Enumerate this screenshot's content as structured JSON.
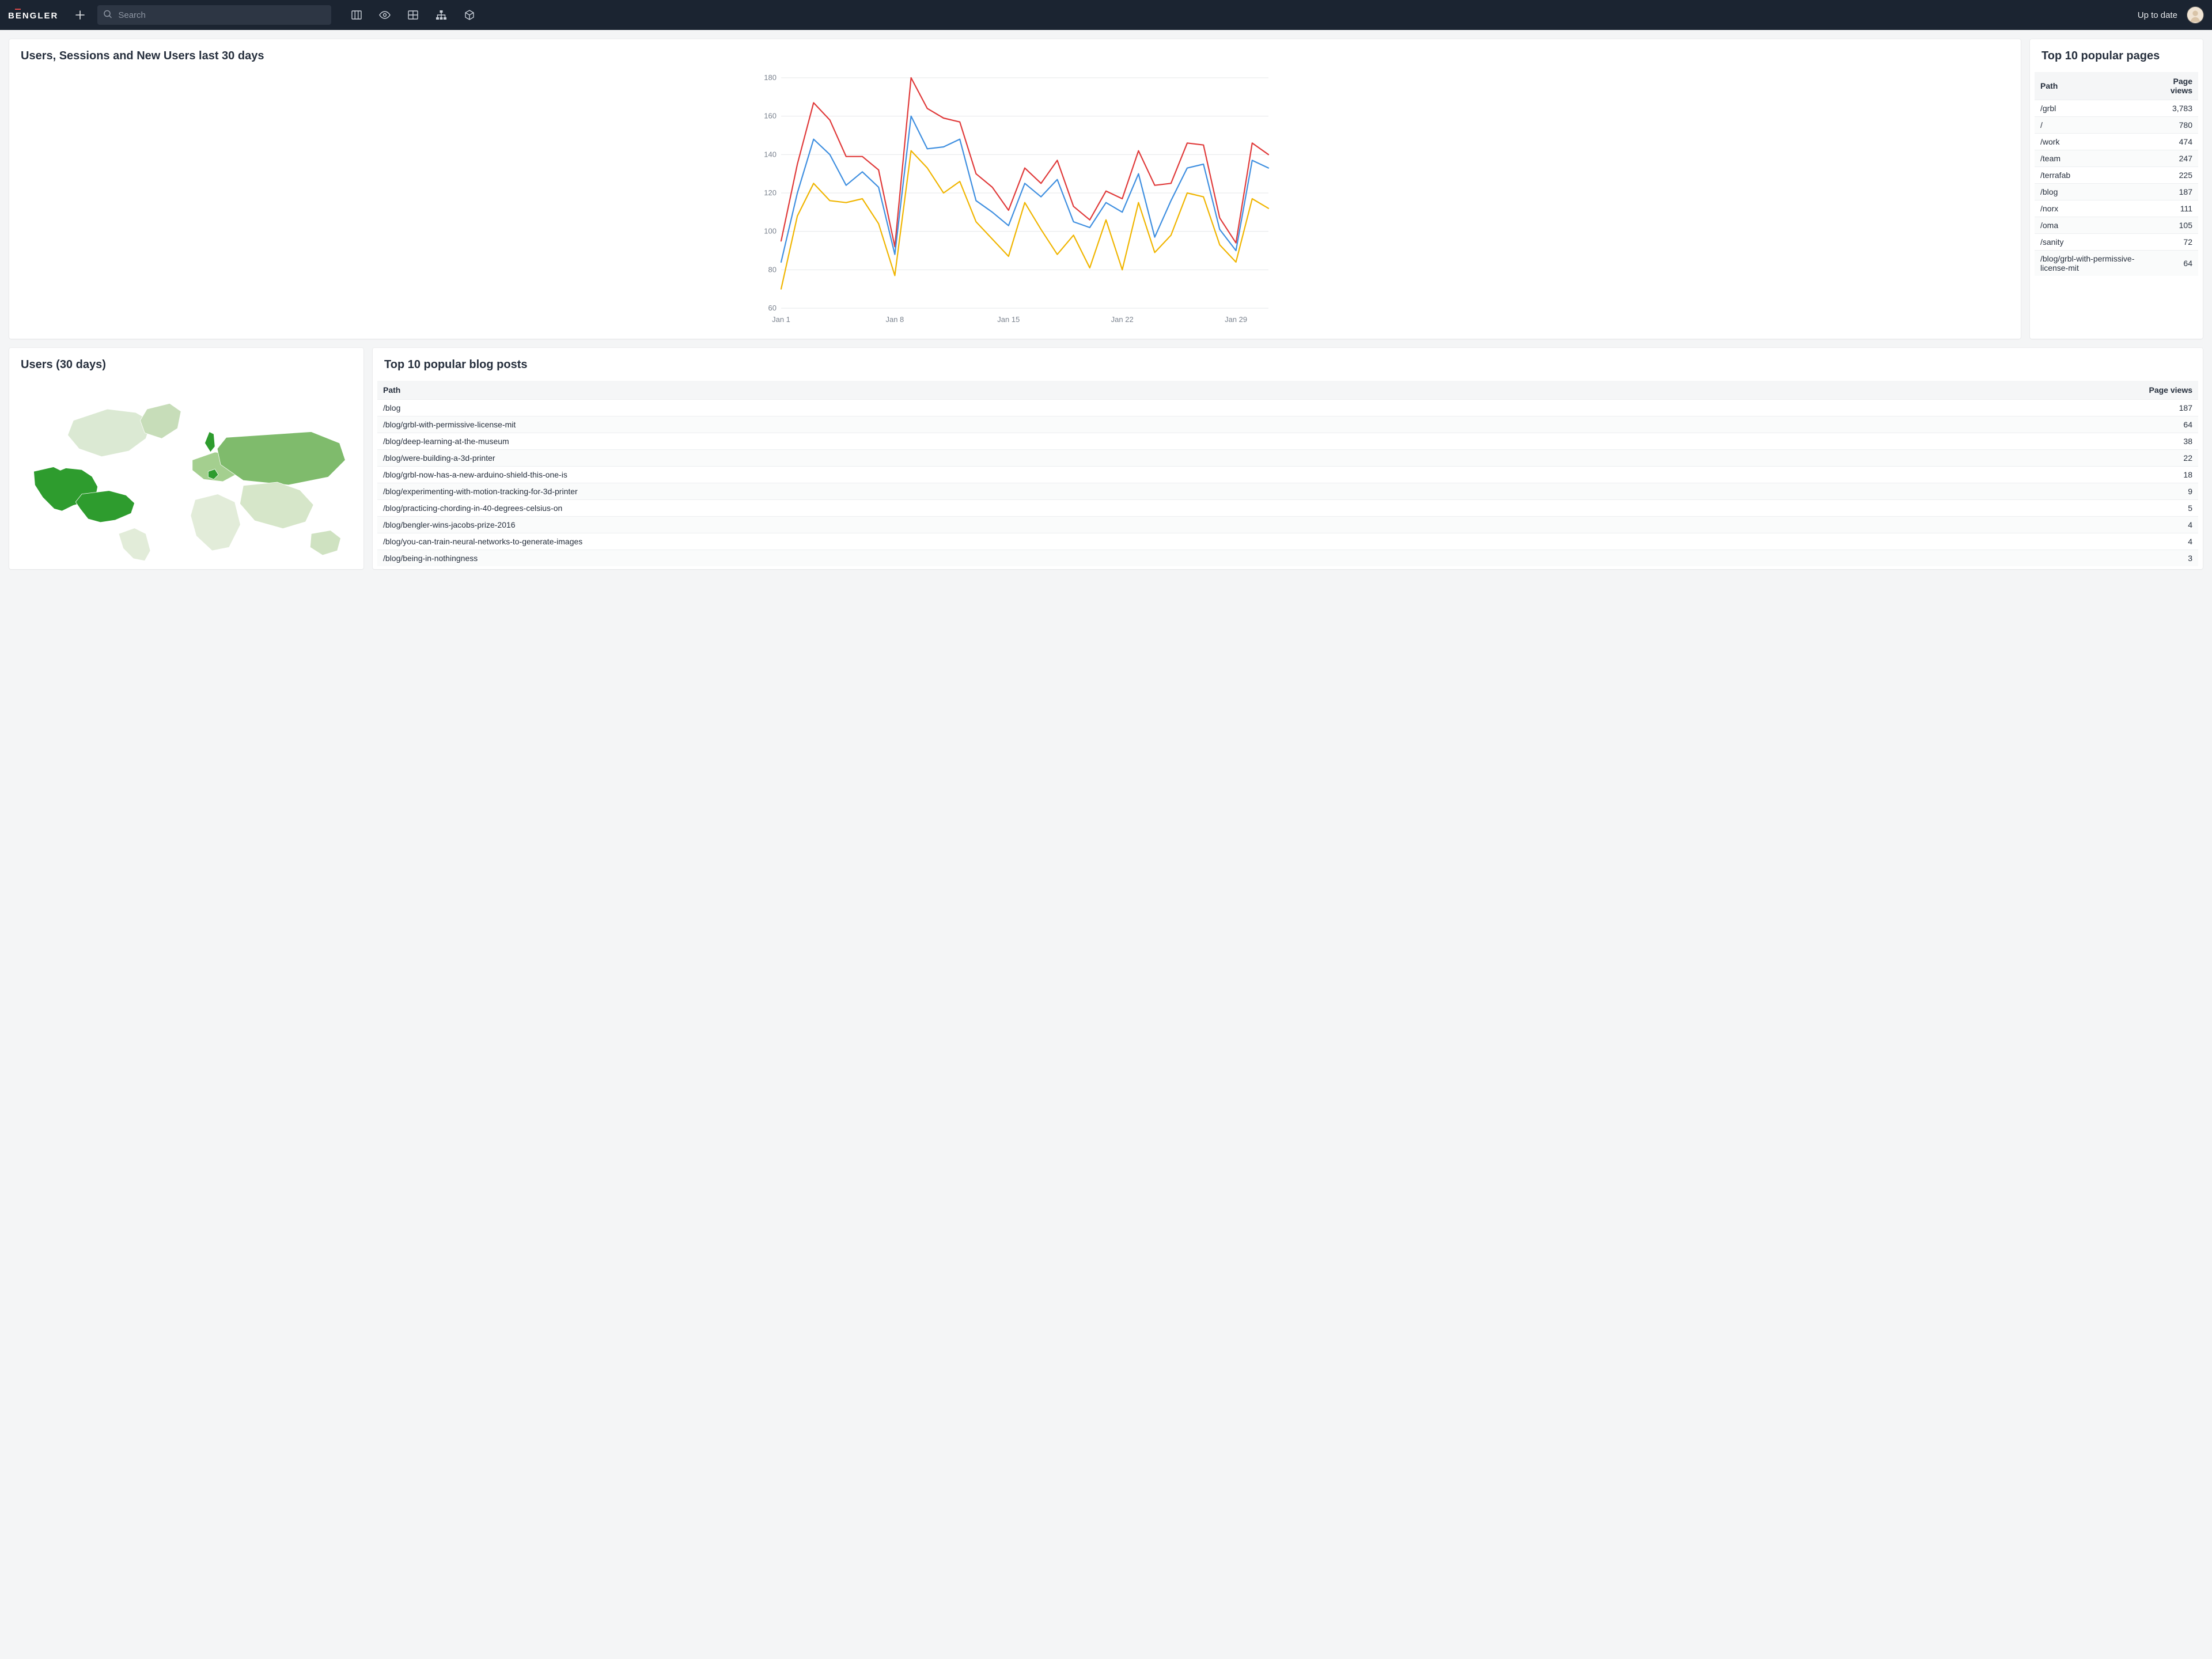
{
  "header": {
    "logo_text": "BENGLER",
    "search_placeholder": "Search",
    "status_label": "Up to date"
  },
  "chart_panel": {
    "title": "Users, Sessions and New Users last 30 days"
  },
  "top_pages": {
    "title": "Top 10 popular pages",
    "col_path": "Path",
    "col_views": "Page views",
    "rows": [
      {
        "path": "/grbl",
        "views": "3,783"
      },
      {
        "path": "/",
        "views": "780"
      },
      {
        "path": "/work",
        "views": "474"
      },
      {
        "path": "/team",
        "views": "247"
      },
      {
        "path": "/terrafab",
        "views": "225"
      },
      {
        "path": "/blog",
        "views": "187"
      },
      {
        "path": "/norx",
        "views": "111"
      },
      {
        "path": "/oma",
        "views": "105"
      },
      {
        "path": "/sanity",
        "views": "72"
      },
      {
        "path": "/blog/grbl-with-permissive-license-mit",
        "views": "64"
      }
    ]
  },
  "users_map": {
    "title": "Users (30 days)"
  },
  "top_blogs": {
    "title": "Top 10 popular blog posts",
    "col_path": "Path",
    "col_views": "Page views",
    "rows": [
      {
        "path": "/blog",
        "views": "187"
      },
      {
        "path": "/blog/grbl-with-permissive-license-mit",
        "views": "64"
      },
      {
        "path": "/blog/deep-learning-at-the-museum",
        "views": "38"
      },
      {
        "path": "/blog/were-building-a-3d-printer",
        "views": "22"
      },
      {
        "path": "/blog/grbl-now-has-a-new-arduino-shield-this-one-is",
        "views": "18"
      },
      {
        "path": "/blog/experimenting-with-motion-tracking-for-3d-printer",
        "views": "9"
      },
      {
        "path": "/blog/practicing-chording-in-40-degrees-celsius-on",
        "views": "5"
      },
      {
        "path": "/blog/bengler-wins-jacobs-prize-2016",
        "views": "4"
      },
      {
        "path": "/blog/you-can-train-neural-networks-to-generate-images",
        "views": "4"
      },
      {
        "path": "/blog/being-in-nothingness",
        "views": "3"
      }
    ]
  },
  "chart_data": {
    "type": "line",
    "title": "Users, Sessions and New Users last 30 days",
    "xlabel": "",
    "ylabel": "",
    "ylim": [
      60,
      180
    ],
    "y_ticks": [
      60,
      80,
      100,
      120,
      140,
      160,
      180
    ],
    "x_categories": [
      "Jan 1",
      "Jan 2",
      "Jan 3",
      "Jan 4",
      "Jan 5",
      "Jan 6",
      "Jan 7",
      "Jan 8",
      "Jan 9",
      "Jan 10",
      "Jan 11",
      "Jan 12",
      "Jan 13",
      "Jan 14",
      "Jan 15",
      "Jan 16",
      "Jan 17",
      "Jan 18",
      "Jan 19",
      "Jan 20",
      "Jan 21",
      "Jan 22",
      "Jan 23",
      "Jan 24",
      "Jan 25",
      "Jan 26",
      "Jan 27",
      "Jan 28",
      "Jan 29",
      "Jan 30",
      "Jan 31"
    ],
    "x_tick_labels": [
      "Jan 1",
      "Jan 8",
      "Jan 15",
      "Jan 22",
      "Jan 29"
    ],
    "x_tick_indices": [
      0,
      7,
      14,
      21,
      28
    ],
    "series": [
      {
        "name": "Sessions",
        "color": "#e03a3a",
        "values": [
          95,
          135,
          167,
          158,
          139,
          139,
          132,
          92,
          180,
          164,
          159,
          157,
          130,
          123,
          111,
          133,
          125,
          137,
          113,
          106,
          121,
          117,
          142,
          124,
          125,
          146,
          145,
          107,
          94,
          146,
          140
        ]
      },
      {
        "name": "Users",
        "color": "#3f8fe0",
        "values": [
          84,
          120,
          148,
          140,
          124,
          131,
          123,
          88,
          160,
          143,
          144,
          148,
          116,
          110,
          103,
          125,
          118,
          127,
          105,
          102,
          115,
          110,
          130,
          97,
          116,
          133,
          135,
          101,
          90,
          137,
          133
        ]
      },
      {
        "name": "New Users",
        "color": "#f0b500",
        "values": [
          70,
          108,
          125,
          116,
          115,
          117,
          104,
          77,
          142,
          133,
          120,
          126,
          105,
          96,
          87,
          115,
          101,
          88,
          98,
          81,
          106,
          80,
          115,
          89,
          98,
          120,
          118,
          93,
          84,
          117,
          112
        ]
      }
    ]
  }
}
